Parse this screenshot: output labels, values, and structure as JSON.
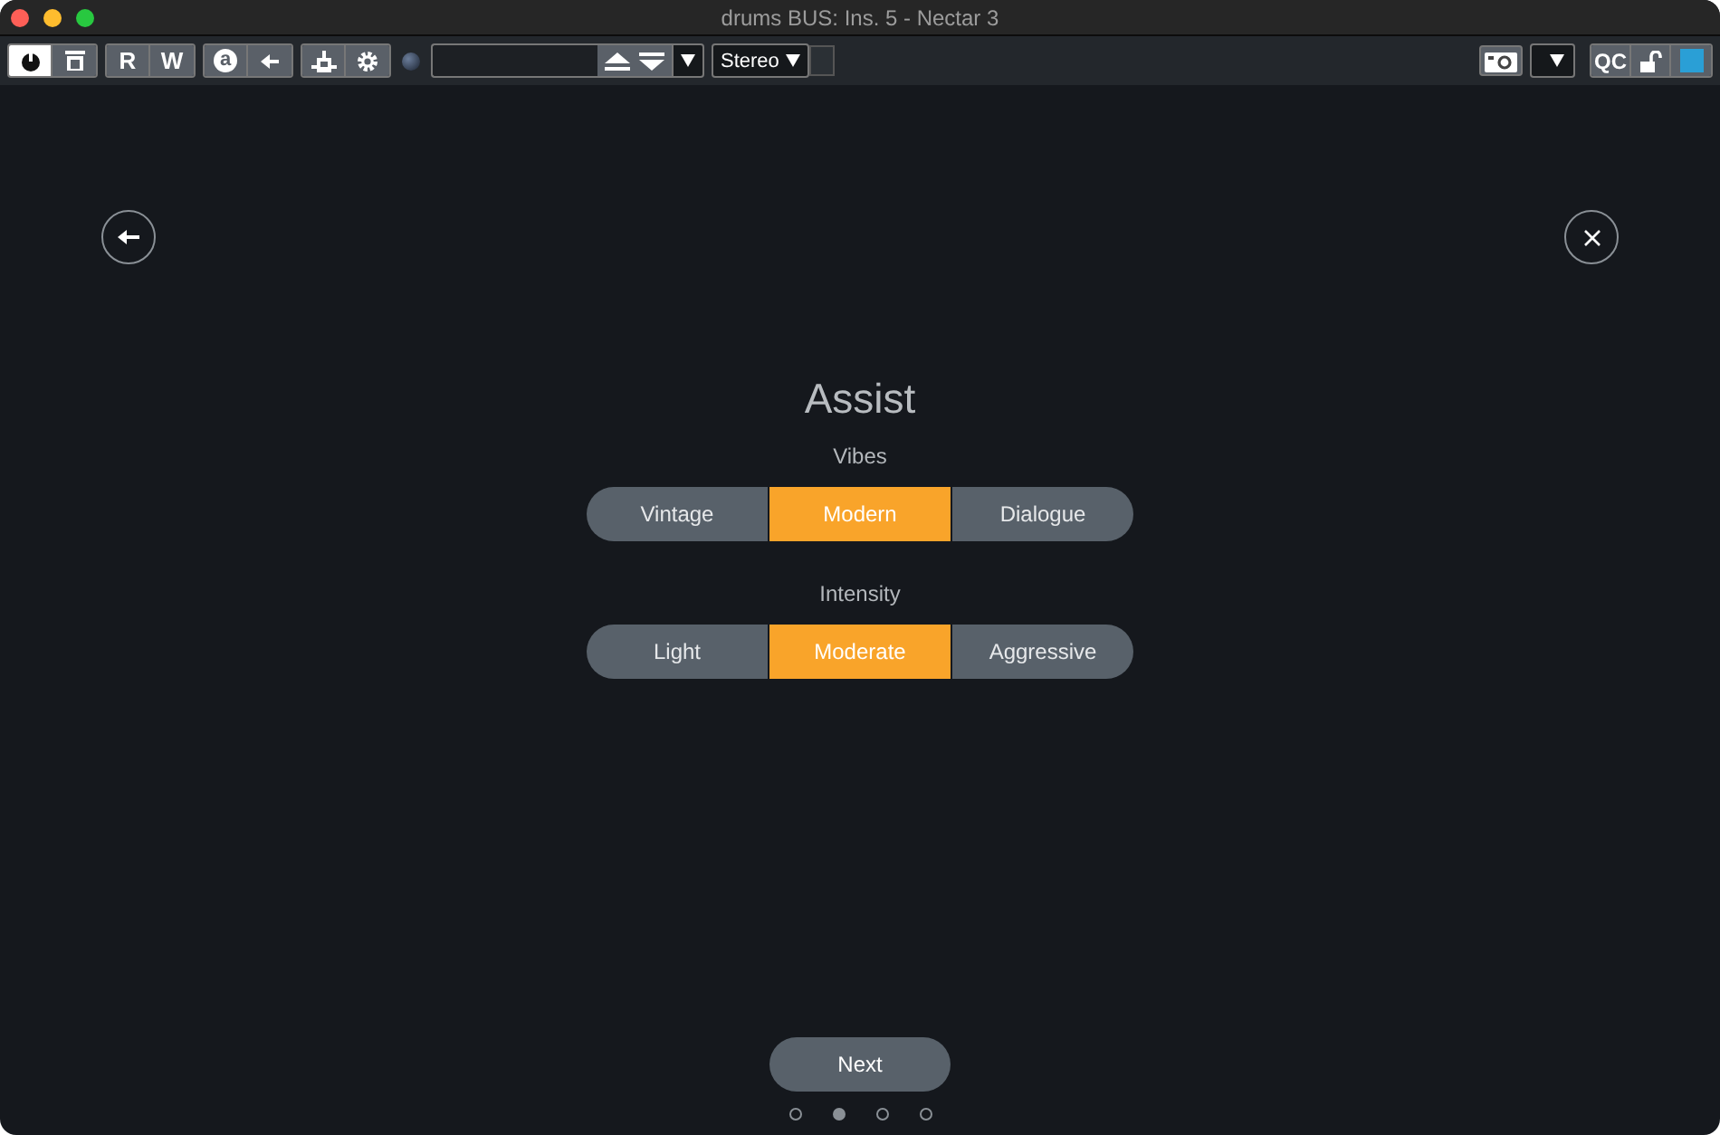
{
  "window": {
    "title": "drums BUS: Ins. 5 - Nectar 3"
  },
  "toolbar": {
    "power_on": true,
    "read": "R",
    "write": "W",
    "auto": "a",
    "channel_mode": "Stereo",
    "qc": "QC"
  },
  "assist": {
    "title": "Assist",
    "groups": [
      {
        "label": "Vibes",
        "options": [
          {
            "label": "Vintage",
            "selected": false
          },
          {
            "label": "Modern",
            "selected": true
          },
          {
            "label": "Dialogue",
            "selected": false
          }
        ]
      },
      {
        "label": "Intensity",
        "options": [
          {
            "label": "Light",
            "selected": false
          },
          {
            "label": "Moderate",
            "selected": true
          },
          {
            "label": "Aggressive",
            "selected": false
          }
        ]
      }
    ],
    "next": "Next",
    "pages": [
      {
        "selected": false
      },
      {
        "selected": true
      },
      {
        "selected": false
      },
      {
        "selected": false
      }
    ]
  }
}
